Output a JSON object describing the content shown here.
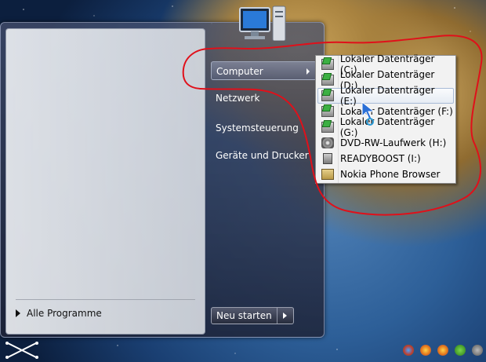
{
  "start_menu": {
    "all_programs_label": "Alle Programme",
    "right_items": [
      {
        "label": "Computer",
        "has_submenu": true,
        "active": true
      },
      {
        "label": "Netzwerk"
      },
      {
        "label": "Systemsteuerung"
      },
      {
        "label": "Geräte und Drucker"
      }
    ],
    "restart_label": "Neu starten"
  },
  "computer_submenu": {
    "items": [
      {
        "label": "Lokaler Datenträger (C:)",
        "icon": "hard-drive-icon"
      },
      {
        "label": "Lokaler Datenträger (D:)",
        "icon": "hard-drive-icon"
      },
      {
        "label": "Lokaler Datenträger (E:)",
        "icon": "hard-drive-icon",
        "hovered": true
      },
      {
        "label": "Lokaler Datenträger (F:)",
        "icon": "hard-drive-icon"
      },
      {
        "label": "Lokaler Datenträger (G:)",
        "icon": "hard-drive-icon"
      },
      {
        "label": "DVD-RW-Laufwerk (H:)",
        "icon": "dvd-drive-icon"
      },
      {
        "label": "READYBOOST (I:)",
        "icon": "usb-drive-icon"
      },
      {
        "label": "Nokia Phone Browser",
        "icon": "phone-browser-icon"
      }
    ]
  },
  "colors": {
    "annotation": "#e0101a",
    "submenu_hover_border": "#a8bbd6"
  }
}
